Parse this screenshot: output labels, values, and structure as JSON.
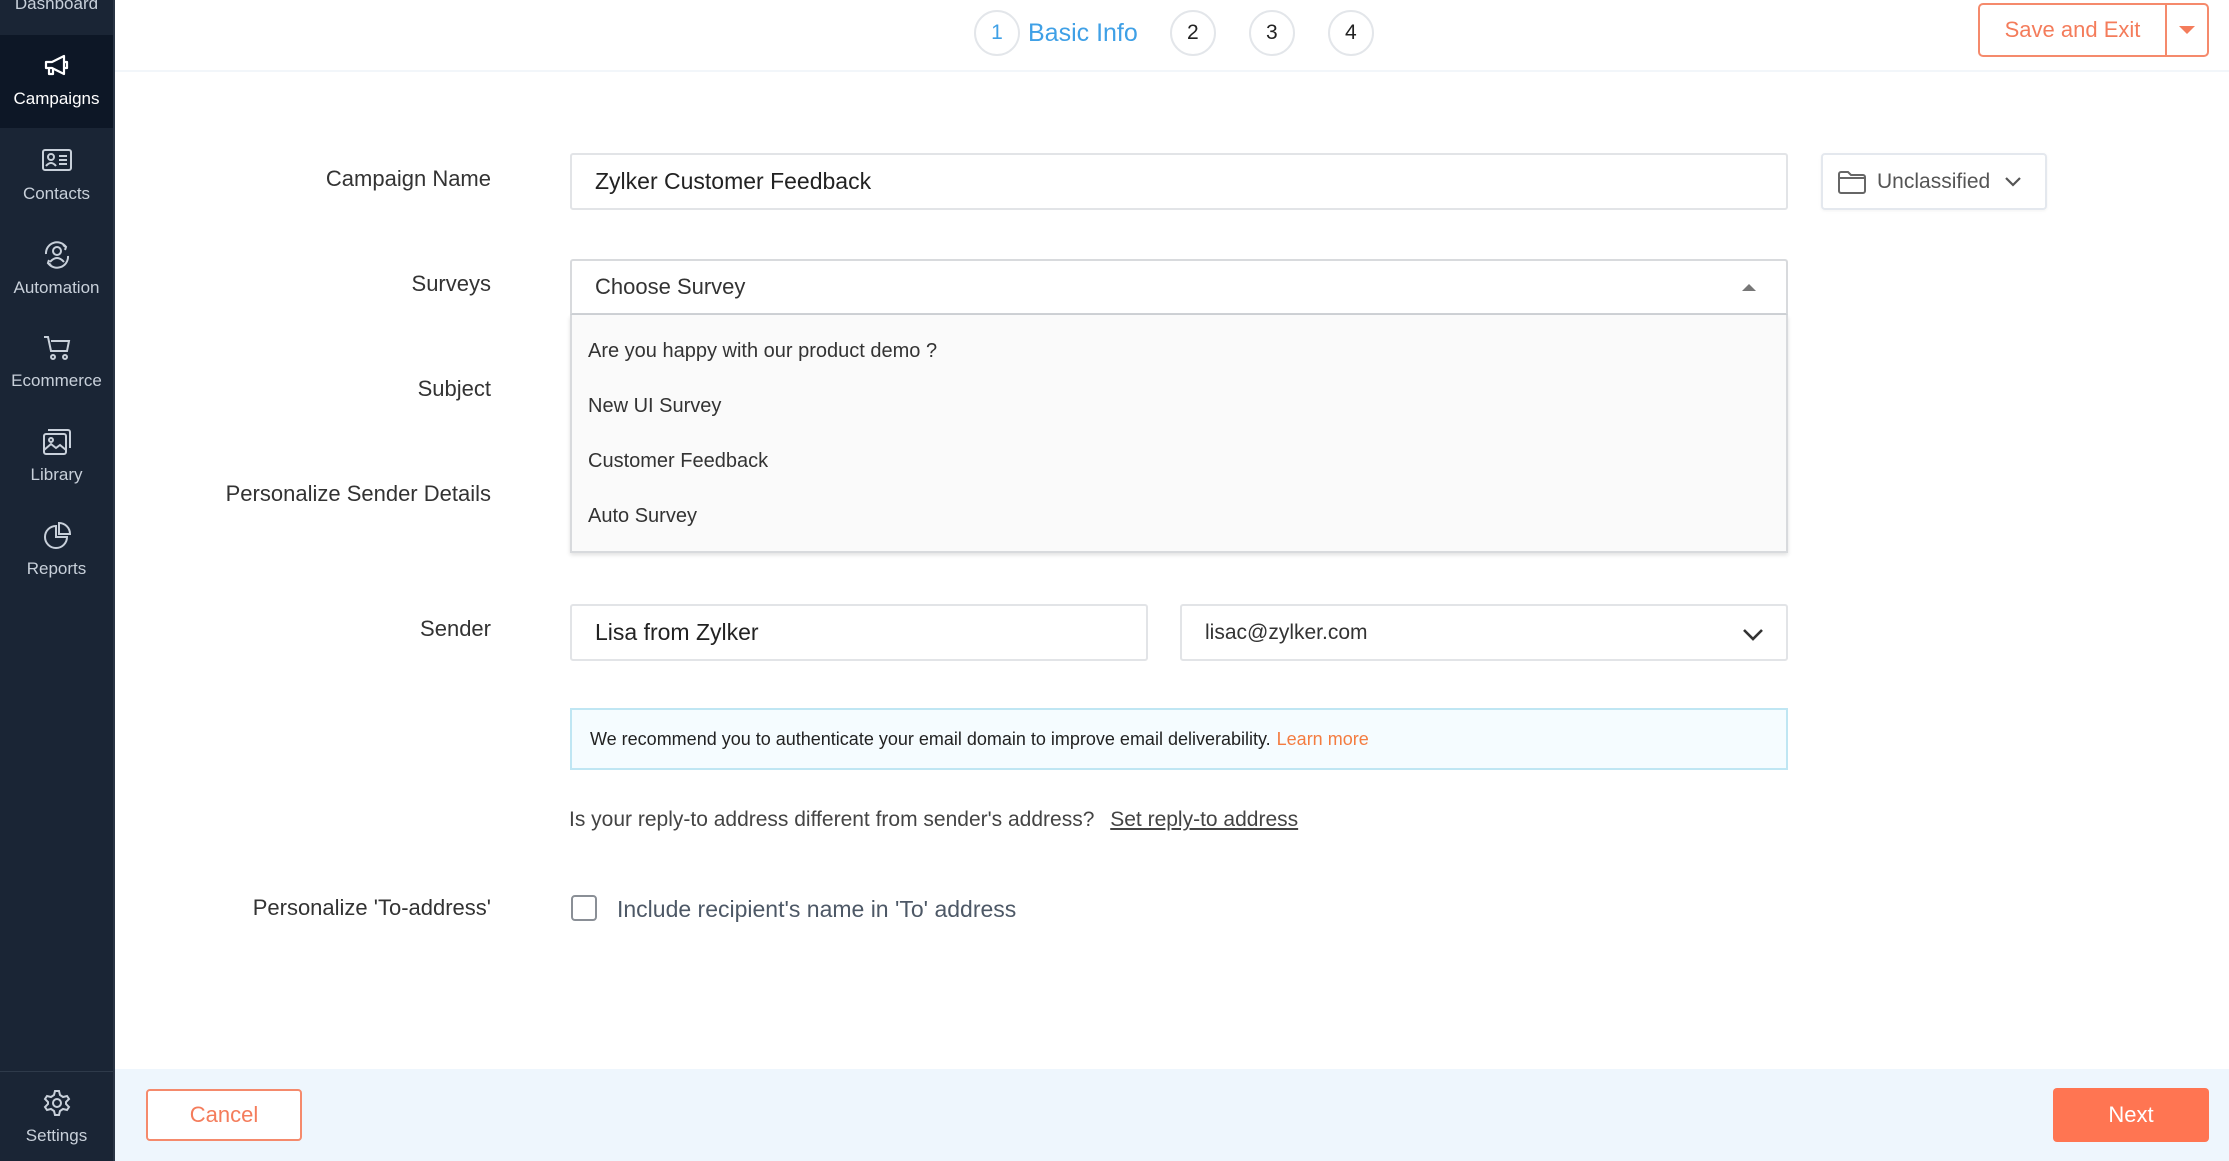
{
  "sidebar": {
    "items": [
      {
        "label": "Dashboard",
        "icon": "dashboard-icon",
        "active": false
      },
      {
        "label": "Campaigns",
        "icon": "megaphone-icon",
        "active": true
      },
      {
        "label": "Contacts",
        "icon": "contact-card-icon",
        "active": false
      },
      {
        "label": "Automation",
        "icon": "automation-icon",
        "active": false
      },
      {
        "label": "Ecommerce",
        "icon": "cart-icon",
        "active": false
      },
      {
        "label": "Library",
        "icon": "image-library-icon",
        "active": false
      },
      {
        "label": "Reports",
        "icon": "pie-chart-icon",
        "active": false
      }
    ],
    "settings_label": "Settings"
  },
  "steps": {
    "items": [
      {
        "number": "1",
        "label": "Basic Info",
        "active": true
      },
      {
        "number": "2"
      },
      {
        "number": "3"
      },
      {
        "number": "4"
      }
    ]
  },
  "toolbar": {
    "save_exit_label": "Save and Exit"
  },
  "form": {
    "campaign_name": {
      "label": "Campaign Name",
      "value": "Zylker Customer Feedback"
    },
    "folder": {
      "label": "Unclassified"
    },
    "surveys": {
      "label": "Surveys",
      "placeholder": "Choose Survey",
      "options": [
        "Are you happy with our product demo ?",
        "New UI Survey",
        "Customer Feedback",
        "Auto Survey"
      ]
    },
    "subject": {
      "label": "Subject"
    },
    "personalize_sender": {
      "label": "Personalize Sender Details"
    },
    "sender": {
      "label": "Sender",
      "name_value": "Lisa from Zylker",
      "email_value": "lisac@zylker.com"
    },
    "info": {
      "text": "We recommend you to authenticate your email domain to improve email deliverability.",
      "link": "Learn more"
    },
    "reply_to": {
      "question": "Is your reply-to address different from sender's address?",
      "link": "Set reply-to address"
    },
    "to_address": {
      "label": "Personalize 'To-address'",
      "checkbox_label": "Include recipient's name in 'To' address",
      "checked": false
    }
  },
  "footer": {
    "cancel_label": "Cancel",
    "next_label": "Next"
  },
  "colors": {
    "accent": "#ff7552",
    "step_active": "#3fa0e6",
    "sidebar_bg": "#1a2535",
    "link_orange": "#f47c40"
  }
}
